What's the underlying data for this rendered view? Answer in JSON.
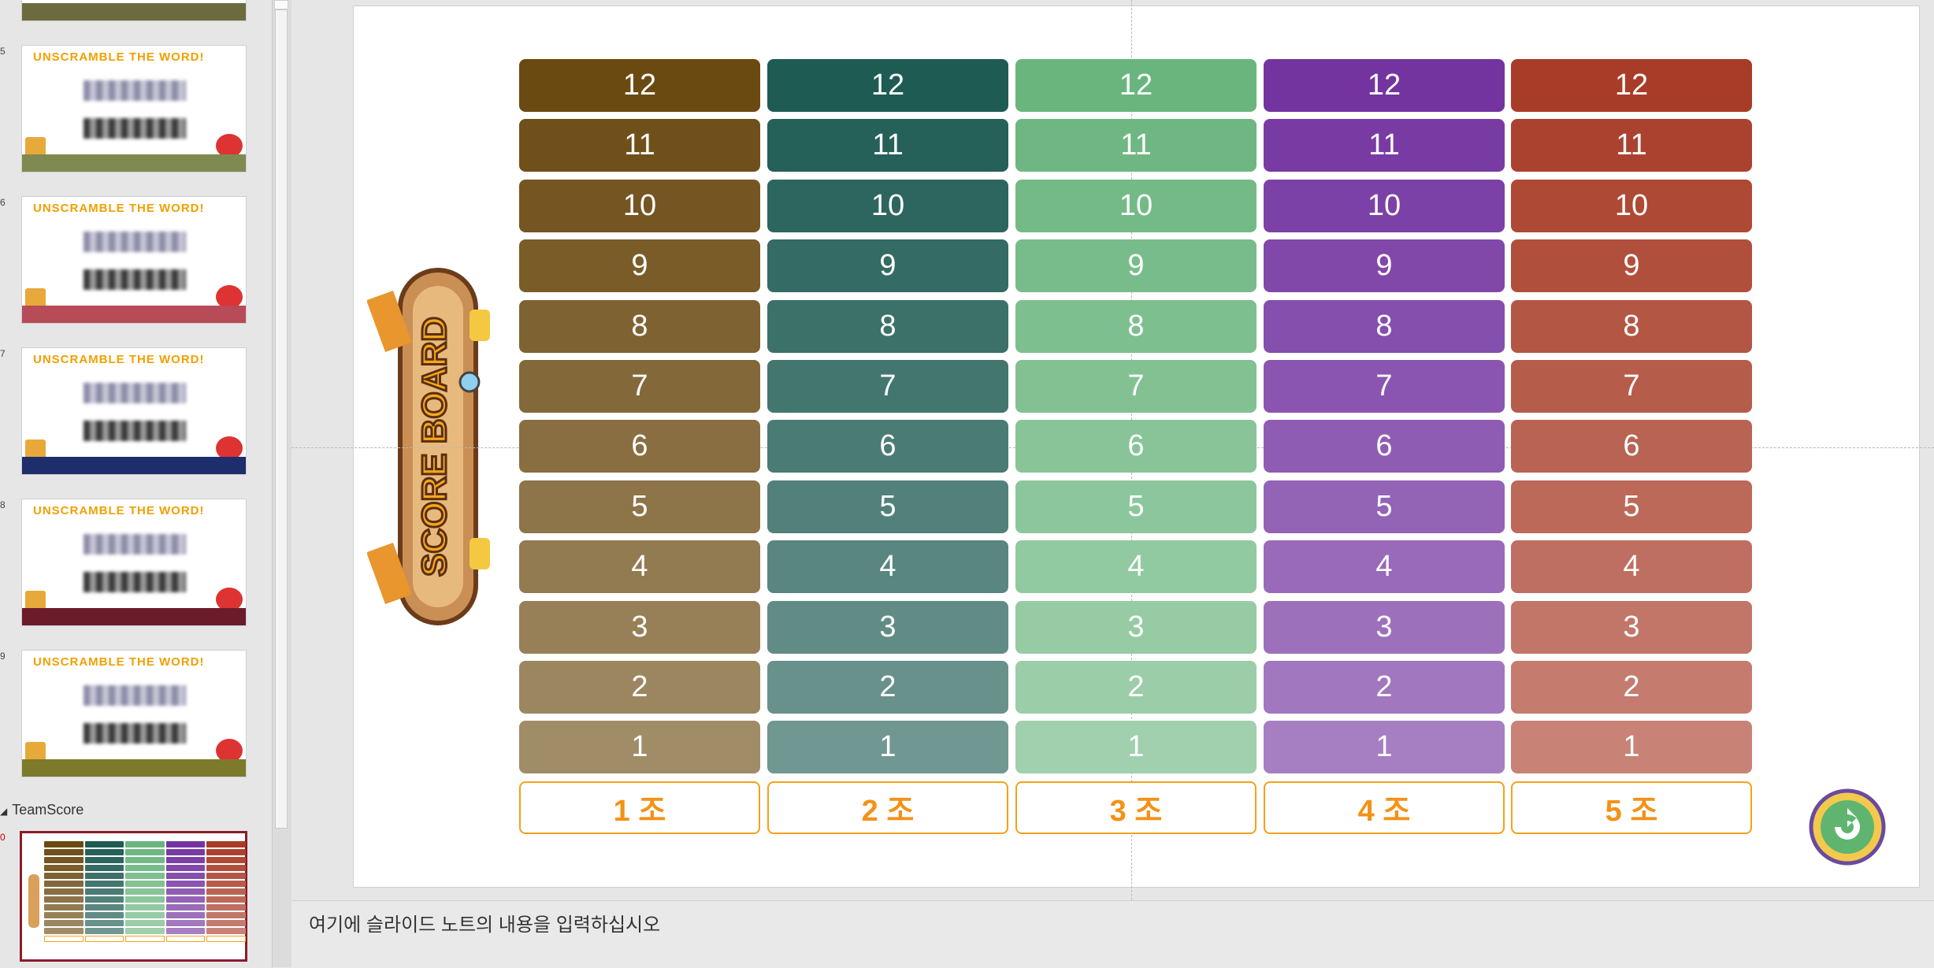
{
  "thumbnails": {
    "slide_numbers": [
      "5",
      "6",
      "7",
      "8",
      "9"
    ],
    "banner_text": "UNSCRAMBLE THE WORD!",
    "footer_colors": [
      "#7e8a50",
      "#b84b58",
      "#1e2d6b",
      "#6b1b2a",
      "#7d7a2b"
    ],
    "section_label": "TeamScore",
    "active_slide_number": "0"
  },
  "scoreboard": {
    "sign_text": "SCORE BOARD",
    "rows": [
      "12",
      "11",
      "10",
      "9",
      "8",
      "7",
      "6",
      "5",
      "4",
      "3",
      "2",
      "1"
    ],
    "teams": [
      {
        "label": "1 조",
        "color": "#6b4a12"
      },
      {
        "label": "2 조",
        "color": "#1e5b53"
      },
      {
        "label": "3 조",
        "color": "#6ab57e"
      },
      {
        "label": "4 조",
        "color": "#7334a0"
      },
      {
        "label": "5 조",
        "color": "#a83c28"
      }
    ],
    "team_label_color": "#f39217"
  },
  "notes": {
    "placeholder": "여기에 슬라이드 노트의 내용을 입력하십시오"
  }
}
